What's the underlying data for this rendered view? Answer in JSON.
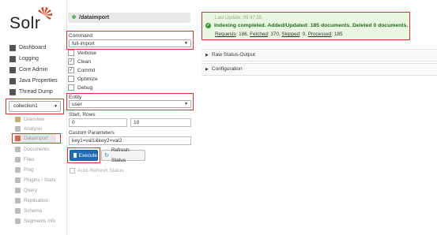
{
  "app": {
    "logo_text": "Solr"
  },
  "sidebar": {
    "items": [
      {
        "label": "Dashboard",
        "icon": "dashboard-icon"
      },
      {
        "label": "Logging",
        "icon": "logging-icon"
      },
      {
        "label": "Core Admin",
        "icon": "core-admin-icon"
      },
      {
        "label": "Java Properties",
        "icon": "java-icon"
      },
      {
        "label": "Thread Dump",
        "icon": "thread-dump-icon"
      }
    ],
    "collection_selected": "collection1",
    "core_items": [
      {
        "label": "Overview",
        "icon": "overview-icon"
      },
      {
        "label": "Analysis",
        "icon": "analysis-icon"
      },
      {
        "label": "Dataimport",
        "icon": "dataimport-icon"
      },
      {
        "label": "Documents",
        "icon": "documents-icon"
      },
      {
        "label": "Files",
        "icon": "files-icon"
      },
      {
        "label": "Ping",
        "icon": "ping-icon"
      },
      {
        "label": "Plugins / Stats",
        "icon": "plugins-icon"
      },
      {
        "label": "Query",
        "icon": "query-icon"
      },
      {
        "label": "Replication",
        "icon": "replication-icon"
      },
      {
        "label": "Schema",
        "icon": "schema-icon"
      },
      {
        "label": "Segments info",
        "icon": "segments-icon"
      }
    ]
  },
  "form": {
    "handler": "/dataimport",
    "command_label": "Command",
    "command_value": "full-import",
    "options": [
      {
        "label": "Verbose",
        "checked": false
      },
      {
        "label": "Clean",
        "checked": true
      },
      {
        "label": "Commit",
        "checked": true
      },
      {
        "label": "Optimize",
        "checked": false
      },
      {
        "label": "Debug",
        "checked": false
      }
    ],
    "entity_label": "Entity",
    "entity_value": "user",
    "start_rows_label": "Start, Rows",
    "start_value": "0",
    "rows_value": "10",
    "custom_params_label": "Custom Parameters",
    "custom_params_value": "key1=val1&key2=val2",
    "execute_label": "Execute",
    "refresh_label": "Refresh Status",
    "auto_refresh_label": "Auto-Refresh Status"
  },
  "status": {
    "last_update": "Last Update: 09:47:35",
    "message": "Indexing completed. Added/Updated: 185 documents. Deleted 0 documents.",
    "requests_label": "Requests",
    "requests": "186",
    "fetched_label": "Fetched",
    "fetched": "370",
    "skipped_label": "Skipped",
    "skipped": "0",
    "processed_label": "Processed",
    "processed": "185",
    "success_color": "#1e6f1e",
    "panel_color": "#eaf6e0"
  },
  "sections": {
    "raw": "Raw Status-Output",
    "config": "Configuration"
  }
}
